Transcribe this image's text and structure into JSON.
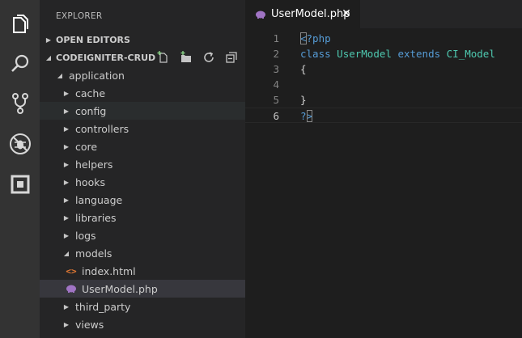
{
  "colors": {
    "accent": "#569cd6",
    "class_name": "#4ec9b0",
    "php_icon": "#a074c4",
    "html_icon": "#e37933",
    "activity_icon": "#d7d7d7",
    "sidebar_bg": "#252526",
    "editor_bg": "#1e1e1e"
  },
  "activity_bar": {
    "items": [
      {
        "icon": "files-icon"
      },
      {
        "icon": "search-icon"
      },
      {
        "icon": "source-control-icon"
      },
      {
        "icon": "debug-icon"
      },
      {
        "icon": "extensions-icon"
      }
    ]
  },
  "sidebar": {
    "title": "EXPLORER",
    "open_editors": "OPEN EDITORS",
    "project": "CODEIGNITER-CRUD",
    "tree": [
      {
        "label": "application",
        "kind": "folder",
        "state": "open"
      },
      {
        "label": "cache",
        "kind": "folder",
        "state": "closed"
      },
      {
        "label": "config",
        "kind": "folder",
        "state": "closed"
      },
      {
        "label": "controllers",
        "kind": "folder",
        "state": "closed"
      },
      {
        "label": "core",
        "kind": "folder",
        "state": "closed"
      },
      {
        "label": "helpers",
        "kind": "folder",
        "state": "closed"
      },
      {
        "label": "hooks",
        "kind": "folder",
        "state": "closed"
      },
      {
        "label": "language",
        "kind": "folder",
        "state": "closed"
      },
      {
        "label": "libraries",
        "kind": "folder",
        "state": "closed"
      },
      {
        "label": "logs",
        "kind": "folder",
        "state": "closed"
      },
      {
        "label": "models",
        "kind": "folder",
        "state": "open"
      },
      {
        "label": "index.html",
        "kind": "file",
        "icon": "html-icon",
        "glyph": "<>"
      },
      {
        "label": "UserModel.php",
        "kind": "file",
        "icon": "php-icon"
      },
      {
        "label": "third_party",
        "kind": "folder",
        "state": "closed"
      },
      {
        "label": "views",
        "kind": "folder",
        "state": "closed"
      }
    ]
  },
  "tab": {
    "label": "UserModel.php",
    "close_glyph": "✕"
  },
  "editor": {
    "line_numbers": [
      "1",
      "2",
      "3",
      "4",
      "5",
      "6"
    ],
    "lines": [
      {
        "t1": "<",
        "t2": "?php"
      },
      {
        "k1": "class",
        "c1": "UserModel",
        "k2": "extends",
        "c2": "CI_Model"
      },
      {
        "p": "{"
      },
      {
        "p": ""
      },
      {
        "p": "}"
      },
      {
        "t1": "?",
        ">": ">"
      }
    ],
    "current_line": "6"
  }
}
